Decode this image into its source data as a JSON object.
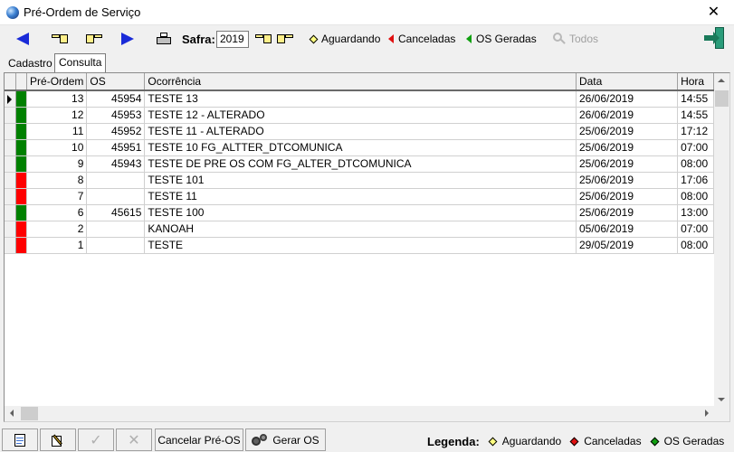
{
  "window": {
    "title": "Pré-Ordem de Serviço",
    "close_glyph": "✕"
  },
  "toolbar": {
    "safra_label": "Safra:",
    "safra_value": "2019",
    "aguardando_label": "Aguardando",
    "canceladas_label": "Canceladas",
    "os_geradas_label": "OS Geradas",
    "todos_label": "Todos"
  },
  "tabs": [
    {
      "label": "Cadastro"
    },
    {
      "label": "Consulta"
    }
  ],
  "grid": {
    "columns": [
      "",
      "",
      "Pré-Ordem",
      "OS",
      "Ocorrência",
      "Data",
      "Hora"
    ],
    "rows": [
      {
        "status": "green",
        "pre_ordem": "13",
        "os": "45954",
        "ocorrencia": "TESTE 13",
        "data": "26/06/2019",
        "hora": "14:55"
      },
      {
        "status": "green",
        "pre_ordem": "12",
        "os": "45953",
        "ocorrencia": "TESTE 12 - ALTERADO",
        "data": "26/06/2019",
        "hora": "14:55"
      },
      {
        "status": "green",
        "pre_ordem": "11",
        "os": "45952",
        "ocorrencia": "TESTE 11 - ALTERADO",
        "data": "25/06/2019",
        "hora": "17:12"
      },
      {
        "status": "green",
        "pre_ordem": "10",
        "os": "45951",
        "ocorrencia": "TESTE 10 FG_ALTTER_DTCOMUNICA",
        "data": "25/06/2019",
        "hora": "07:00"
      },
      {
        "status": "green",
        "pre_ordem": "9",
        "os": "45943",
        "ocorrencia": "TESTE DE PRE OS COM FG_ALTER_DTCOMUNICA",
        "data": "25/06/2019",
        "hora": "08:00"
      },
      {
        "status": "red",
        "pre_ordem": "8",
        "os": "",
        "ocorrencia": "TESTE 101",
        "data": "25/06/2019",
        "hora": "17:06"
      },
      {
        "status": "red",
        "pre_ordem": "7",
        "os": "",
        "ocorrencia": "TESTE 11",
        "data": "25/06/2019",
        "hora": "08:00"
      },
      {
        "status": "green",
        "pre_ordem": "6",
        "os": "45615",
        "ocorrencia": "TESTE 100",
        "data": "25/06/2019",
        "hora": "13:00"
      },
      {
        "status": "red",
        "pre_ordem": "2",
        "os": "",
        "ocorrencia": "KANOAH",
        "data": "05/06/2019",
        "hora": "07:00"
      },
      {
        "status": "red",
        "pre_ordem": "1",
        "os": "",
        "ocorrencia": "TESTE",
        "data": "29/05/2019",
        "hora": "08:00"
      }
    ]
  },
  "bottom": {
    "cancelar_label": "Cancelar Pré-OS",
    "gerar_label": "Gerar OS",
    "legend_title": "Legenda:",
    "legend_aguardando": "Aguardando",
    "legend_canceladas": "Canceladas",
    "legend_os_geradas": "OS Geradas"
  },
  "colors": {
    "green": "#008000",
    "red": "#ff0000",
    "yellow": "#ffff80",
    "legend_red": "#e01010",
    "legend_green": "#10a010"
  }
}
